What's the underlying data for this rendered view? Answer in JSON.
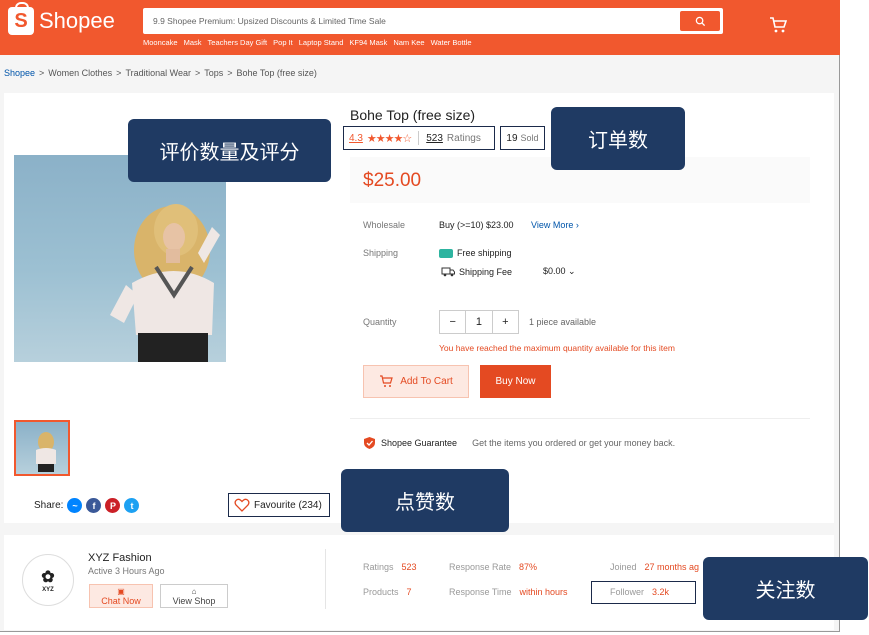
{
  "header": {
    "logo_text": "Shopee",
    "search_placeholder": "9.9 Shopee Premium: Upsized Discounts & Limited Time Sale",
    "hot_keywords": [
      "Mooncake",
      "Mask",
      "Teachers Day Gift",
      "Pop It",
      "Laptop Stand",
      "KF94 Mask",
      "Nam Kee",
      "Water Bottle"
    ],
    "brand_color": "#f1582e"
  },
  "breadcrumb": [
    "Shopee",
    "Women Clothes",
    "Traditional Wear",
    "Tops",
    "Bohe Top (free size)"
  ],
  "breadcrumb_sep": ">",
  "product": {
    "title": "Bohe Top (free size)",
    "rating_value": "4.3",
    "stars": "★★★★☆",
    "ratings_count": "523",
    "ratings_label": "Ratings",
    "sold_count": "19",
    "sold_label": "Sold",
    "price": "$25.00",
    "wholesale_label": "Wholesale",
    "wholesale_value": "Buy (>=10) $23.00",
    "wholesale_link": "View More",
    "shipping_label": "Shipping",
    "free_shipping": "Free shipping",
    "shipping_fee_label": "Shipping Fee",
    "shipping_fee_value": "$0.00",
    "quantity_label": "Quantity",
    "quantity_minus": "−",
    "quantity_value": "1",
    "quantity_plus": "+",
    "available": "1 piece available",
    "max_warning": "You have reached the maximum quantity available for this item",
    "add_to_cart": "Add To Cart",
    "buy_now": "Buy Now",
    "guarantee_title": "Shopee Guarantee",
    "guarantee_desc": "Get the items you ordered or get your money back.",
    "share_label": "Share:",
    "favourite": "Favourite (234)"
  },
  "shop": {
    "name": "XYZ Fashion",
    "active": "Active 3 Hours Ago",
    "logo_text": "XYZ",
    "chat": "Chat Now",
    "view": "View Shop",
    "ratings_label": "Ratings",
    "ratings_value": "523",
    "products_label": "Products",
    "products_value": "7",
    "response_rate_label": "Response Rate",
    "response_rate_value": "87%",
    "response_time_label": "Response Time",
    "response_time_value": "within hours",
    "joined_label": "Joined",
    "joined_value": "27 months ag",
    "follower_label": "Follower",
    "follower_value": "3.2k"
  },
  "annotations": {
    "ratings_callout": "评价数量及评分",
    "orders_callout": "订单数",
    "likes_callout": "点赞数",
    "followers_callout": "关注数",
    "callout_color": "#1f3a63"
  }
}
